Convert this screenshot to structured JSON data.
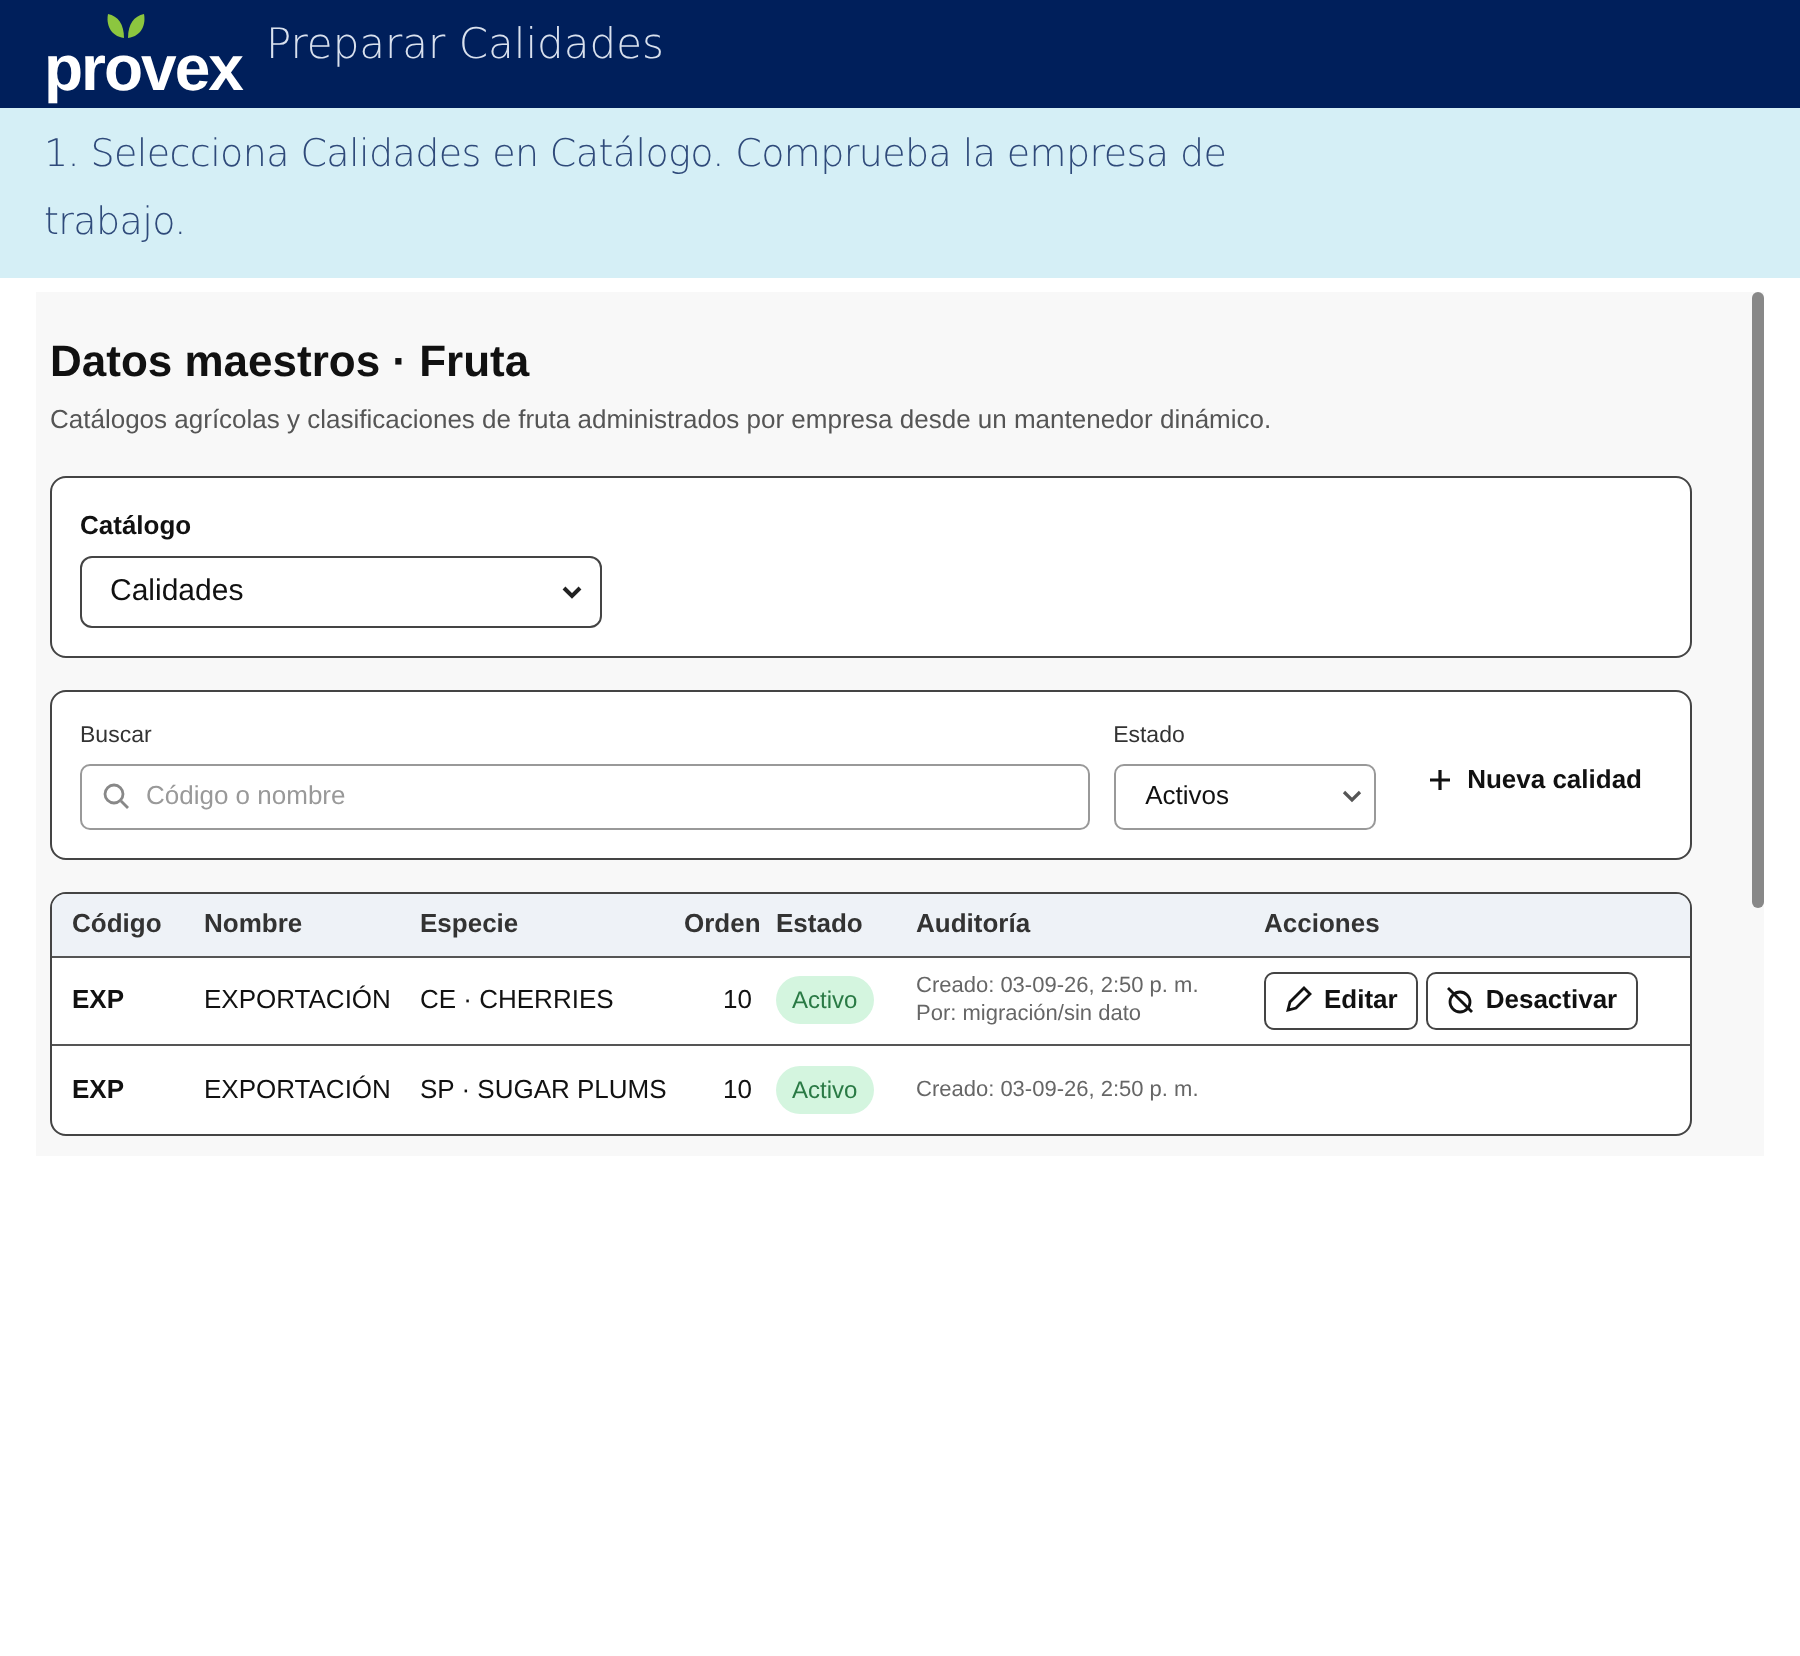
{
  "header": {
    "logo": "provex",
    "title": "Preparar Calidades"
  },
  "instruction": "1. Selecciona Calidades en Catálogo. Comprueba la empresa de trabajo.",
  "screenshot": {
    "heading": "Datos maestros · Fruta",
    "subtitle": "Catálogos agrícolas y clasificaciones de fruta administrados por empresa desde un mantenedor dinámico.",
    "catalog": {
      "label": "Catálogo",
      "value": "Calidades"
    },
    "filters": {
      "search_label": "Buscar",
      "search_placeholder": "Código o nombre",
      "status_label": "Estado",
      "status_value": "Activos",
      "new_button": "Nueva calidad"
    },
    "table": {
      "columns": [
        "Código",
        "Nombre",
        "Especie",
        "Orden",
        "Estado",
        "Auditoría",
        "Acciones"
      ],
      "rows": [
        {
          "code": "EXP",
          "name": "EXPORTACIÓN",
          "species": "CE · CHERRIES",
          "order": "10",
          "status": "Activo",
          "created": "Creado: 03-09-26, 2:50 p. m.",
          "by": "Por: migración/sin dato",
          "actions": [
            "Editar",
            "Desactivar"
          ]
        },
        {
          "code": "EXP",
          "name": "EXPORTACIÓN",
          "species": "SP · SUGAR PLUMS",
          "order": "10",
          "status": "Activo",
          "created": "Creado: 03-09-26, 2:50 p. m.",
          "actions": []
        }
      ]
    }
  }
}
